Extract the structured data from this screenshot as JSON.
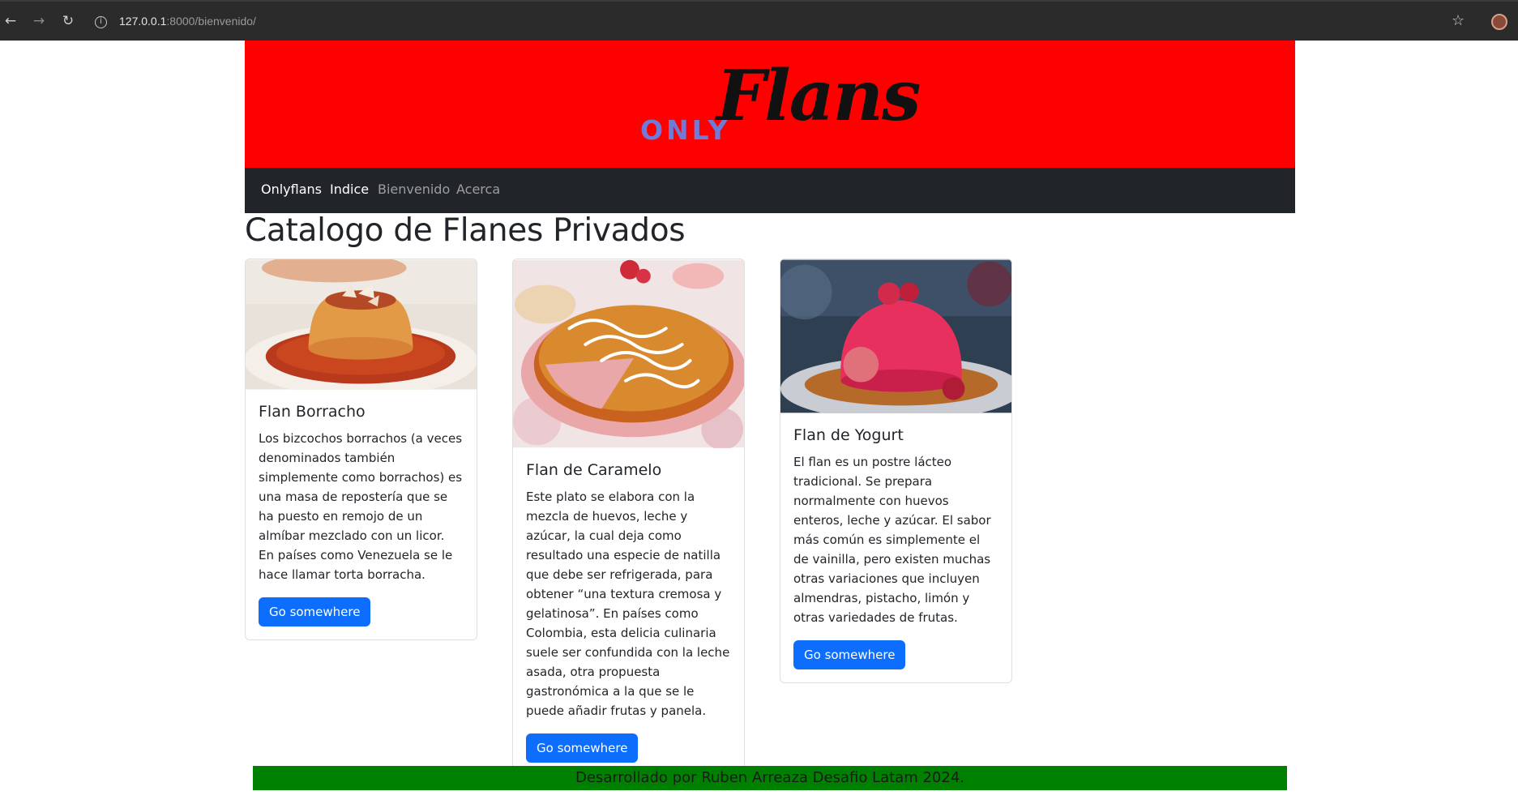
{
  "browser": {
    "back_icon": "←",
    "forward_icon": "→",
    "reload_icon": "↻",
    "url_host": "127.0.0.1",
    "url_path": ":8000/bienvenido/",
    "bookmark_icon": "☆"
  },
  "header": {
    "logo_only": "ONLY",
    "logo_flans": "Flans",
    "banner_color": "#ff0000"
  },
  "navbar": {
    "brand": "Onlyflans",
    "links": [
      "Indice",
      "Bienvenido",
      "Acerca"
    ]
  },
  "main": {
    "title": "Catalogo de Flanes Privados",
    "cards": [
      {
        "title": "Flan Borracho",
        "text": "Los bizcochos borrachos (a veces denominados también simplemente como borrachos) es una masa de repostería que se ha puesto en remojo de un almíbar mezclado con un licor. En países como Venezuela se le hace llamar torta borracha.",
        "button": "Go somewhere"
      },
      {
        "title": "Flan de Caramelo",
        "text": "Este plato se elabora con la mezcla de huevos, leche y azúcar, la cual deja como resultado una especie de natilla que debe ser refrigerada, para obtener “una textura cremosa y gelatinosa”. En países como Colombia, esta delicia culinaria suele ser confundida con la leche asada, otra propuesta gastronómica a la que se le puede añadir frutas y panela.",
        "button": "Go somewhere"
      },
      {
        "title": "Flan de Yogurt",
        "text": "El flan es un postre lácteo tradicional. Se prepara normalmente con huevos enteros, leche y azúcar. El sabor más común es simplemente el de vainilla, pero existen muchas otras variaciones que incluyen almendras, pistacho, limón y otras variedades de frutas.",
        "button": "Go somewhere"
      }
    ]
  },
  "footer": {
    "text": "Desarrollado por Ruben Arreaza Desafio Latam 2024.",
    "color": "#008000"
  }
}
